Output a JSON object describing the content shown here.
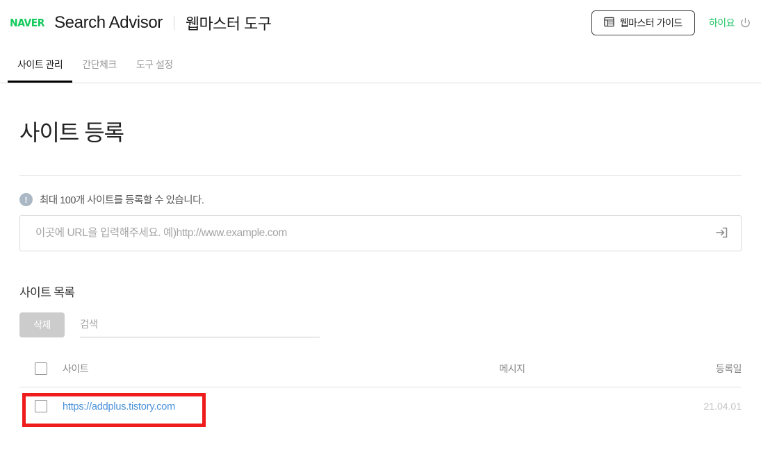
{
  "header": {
    "logo_text": "NAVER",
    "brand": "Search Advisor",
    "service": "웹마스터 도구",
    "guide_button": "웹마스터 가이드",
    "guide_icon": "table-grid-icon",
    "user_name": "하이요",
    "logout_icon": "power-icon",
    "accent_green": "#20c463",
    "logo_green": "#15c95d"
  },
  "tabs": [
    {
      "label": "사이트 관리",
      "active": true
    },
    {
      "label": "간단체크",
      "active": false
    },
    {
      "label": "도구 설정",
      "active": false
    }
  ],
  "main": {
    "page_title": "사이트 등록",
    "notice": "최대 100개 사이트를 등록할 수 있습니다.",
    "notice_icon": "exclamation-circle-icon",
    "url_input": {
      "value": "",
      "placeholder": "이곳에 URL을 입력해주세요. 예)http://www.example.com",
      "submit_icon": "enter-arrow-icon"
    }
  },
  "site_list": {
    "heading": "사이트 목록",
    "delete_button": "삭제",
    "search": {
      "value": "",
      "placeholder": "검색"
    },
    "columns": {
      "select": "",
      "site": "사이트",
      "message": "메시지",
      "date": "등록일"
    },
    "rows": [
      {
        "selected": false,
        "site": "https://addplus.tistory.com",
        "message": "",
        "date": "21.04.01"
      }
    ]
  },
  "annotation": {
    "type": "highlight-rectangle",
    "color": "#ee1c1c"
  }
}
